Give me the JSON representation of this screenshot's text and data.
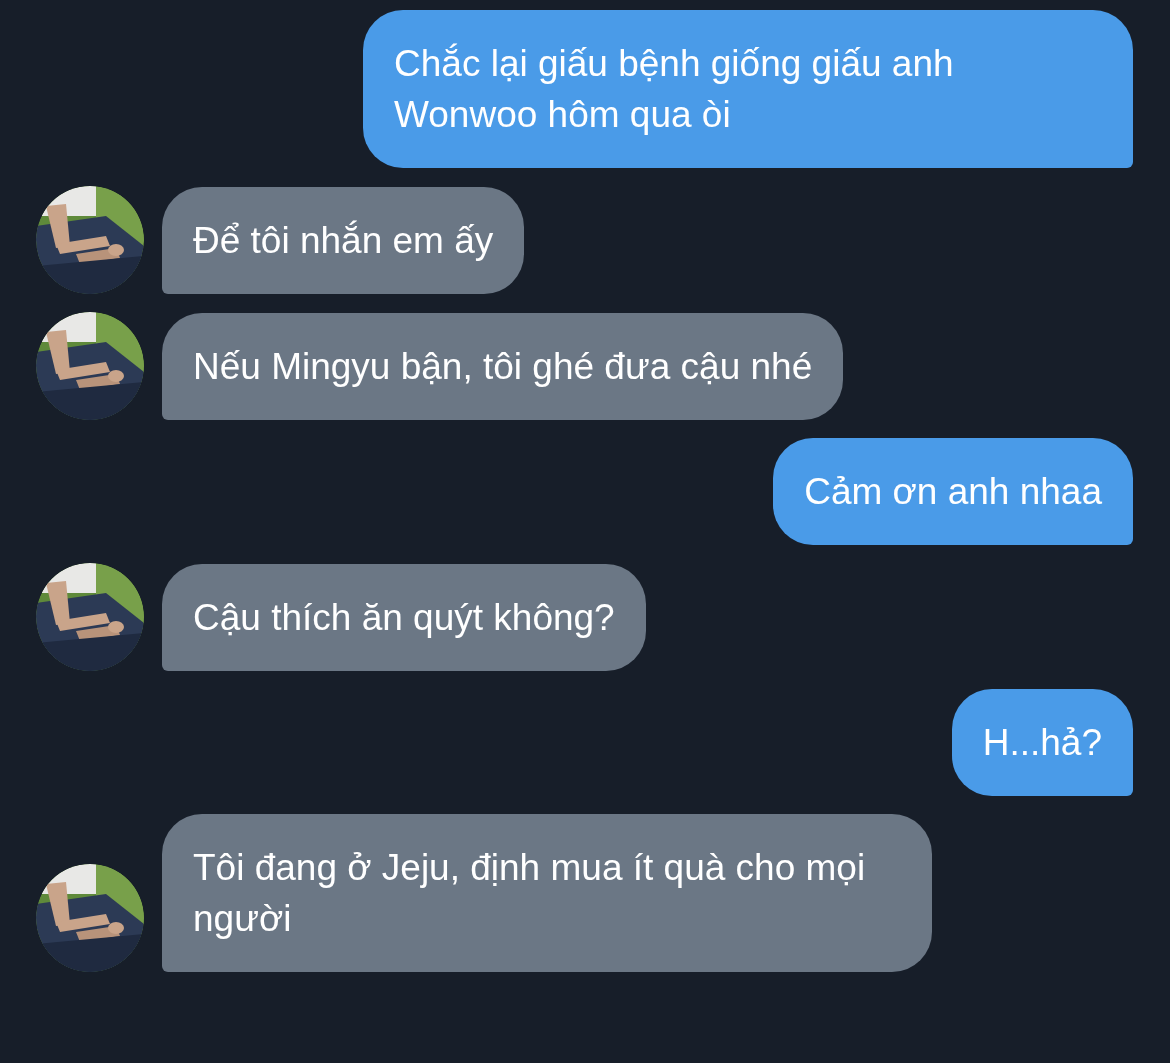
{
  "messages": [
    {
      "kind": "outgoing",
      "text": "Chắc lại giấu bệnh giống giấu anh Wonwoo hôm qua òi"
    },
    {
      "kind": "incoming",
      "text": "Để tôi nhắn em ấy"
    },
    {
      "kind": "incoming",
      "text": "Nếu Mingyu bận, tôi ghé đưa cậu nhé"
    },
    {
      "kind": "outgoing",
      "text": "Cảm ơn anh nhaa"
    },
    {
      "kind": "incoming",
      "text": "Cậu thích ăn quýt không?"
    },
    {
      "kind": "outgoing",
      "text": "H...hả?"
    },
    {
      "kind": "incoming",
      "text": "Tôi đang ở Jeju, định mua ít quà cho mọi người"
    }
  ]
}
